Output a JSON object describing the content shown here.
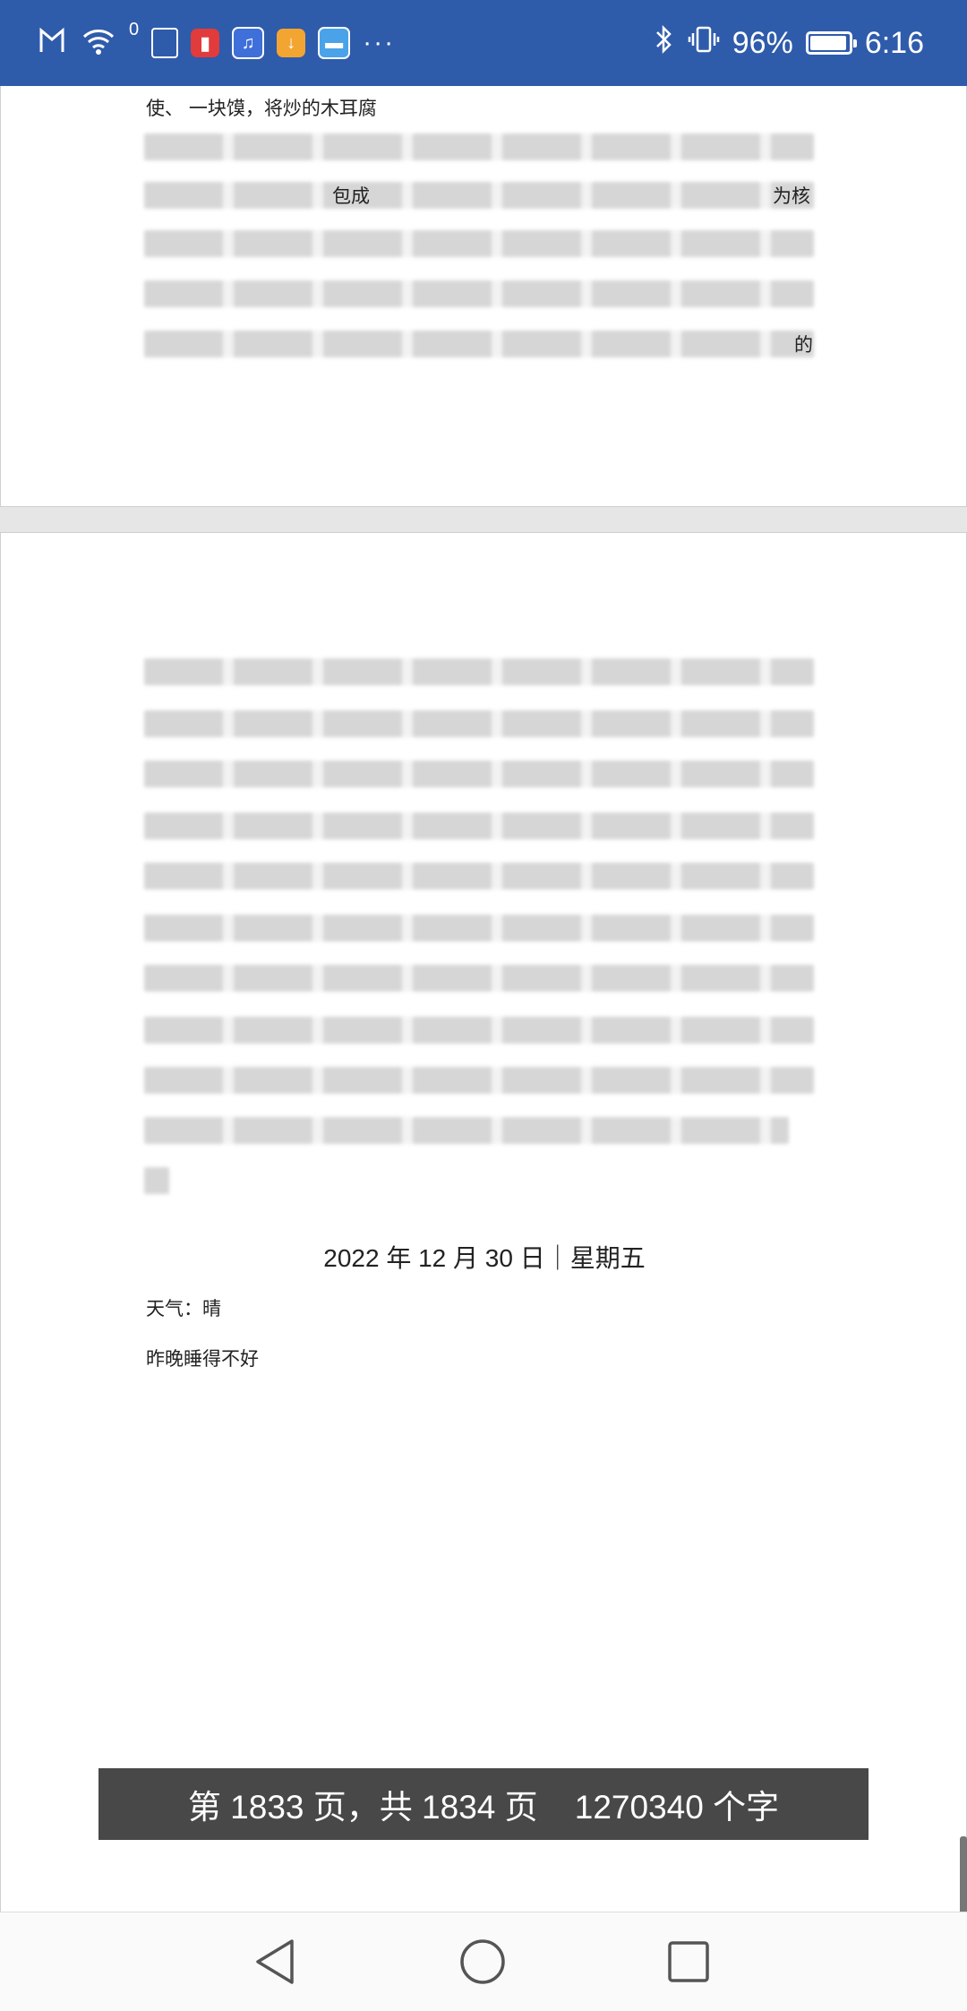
{
  "status_bar": {
    "notif_count": "0",
    "battery": "96%",
    "battery_level": 0.96,
    "time": "6:16",
    "overflow": "···"
  },
  "document": {
    "page1_fragment": "使、 一块馍，将炒的木耳腐",
    "page1_fragment_mid": "包成",
    "page1_fragment_right": "为核",
    "page1_fragment_end": "的",
    "entry": {
      "date": "2022 年 12 月 30 日｜星期五",
      "weather": "天气：晴",
      "body": "昨晚睡得不好"
    }
  },
  "page_indicator": {
    "text": "第 1833 页，共 1834 页    1270340 个字"
  }
}
